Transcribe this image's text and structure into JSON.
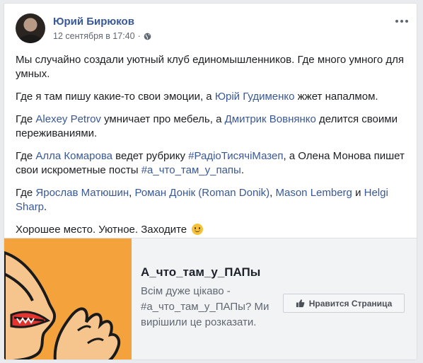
{
  "post": {
    "author": "Юрий Бирюков",
    "timestamp": "12 сентября в 17:40",
    "separator": "·",
    "privacy_icon": "globe-icon",
    "more_icon": "more-dots-icon",
    "paragraphs": [
      [
        {
          "text": "Мы случайно создали уютный клуб единомышленников. Где много умного для умных.",
          "link": false
        }
      ],
      [
        {
          "text": "Где я там пишу какие-то свои эмоции, а ",
          "link": false
        },
        {
          "text": "Юрій Гудименко",
          "link": true
        },
        {
          "text": " жжет напалмом.",
          "link": false
        }
      ],
      [
        {
          "text": "Где ",
          "link": false
        },
        {
          "text": "Alexey Petrov",
          "link": true
        },
        {
          "text": " умничает про мебель, а ",
          "link": false
        },
        {
          "text": "Дмитрик Вовнянко",
          "link": true
        },
        {
          "text": " делится своими переживаниями.",
          "link": false
        }
      ],
      [
        {
          "text": "Где ",
          "link": false
        },
        {
          "text": "Алла Комарова",
          "link": true
        },
        {
          "text": " ведет рубрику ",
          "link": false
        },
        {
          "text": "#РадіоТисячіМазеп",
          "link": true
        },
        {
          "text": ", а Олена Монова пишет свои искрометные посты ",
          "link": false
        },
        {
          "text": "#а_что_там_у_папы",
          "link": true
        },
        {
          "text": ".",
          "link": false
        }
      ],
      [
        {
          "text": "Где ",
          "link": false
        },
        {
          "text": "Ярослав Матюшин",
          "link": true
        },
        {
          "text": ", ",
          "link": false
        },
        {
          "text": "Роман Донік (Roman Donik)",
          "link": true
        },
        {
          "text": ", ",
          "link": false
        },
        {
          "text": "Mason Lemberg",
          "link": true
        },
        {
          "text": " и ",
          "link": false
        },
        {
          "text": "Helgi Sharp",
          "link": true
        },
        {
          "text": ".",
          "link": false
        }
      ],
      [
        {
          "text": "Хорошее место. Уютное. Заходите ",
          "link": false
        },
        {
          "emoji": "smile-emoji-icon"
        }
      ]
    ]
  },
  "shared_page": {
    "title": "А_что_там_у_ПАПы",
    "description": "Всім дуже цікаво - #а_что_там_у_ПАПы? Ми вирішили це розказати.",
    "like_label": "Нравится Страница",
    "like_icon": "thumbs-up-icon",
    "image_icon": "whisper-face-icon"
  },
  "colors": {
    "link": "#385898",
    "thumb_bg": "#f4a23c"
  }
}
